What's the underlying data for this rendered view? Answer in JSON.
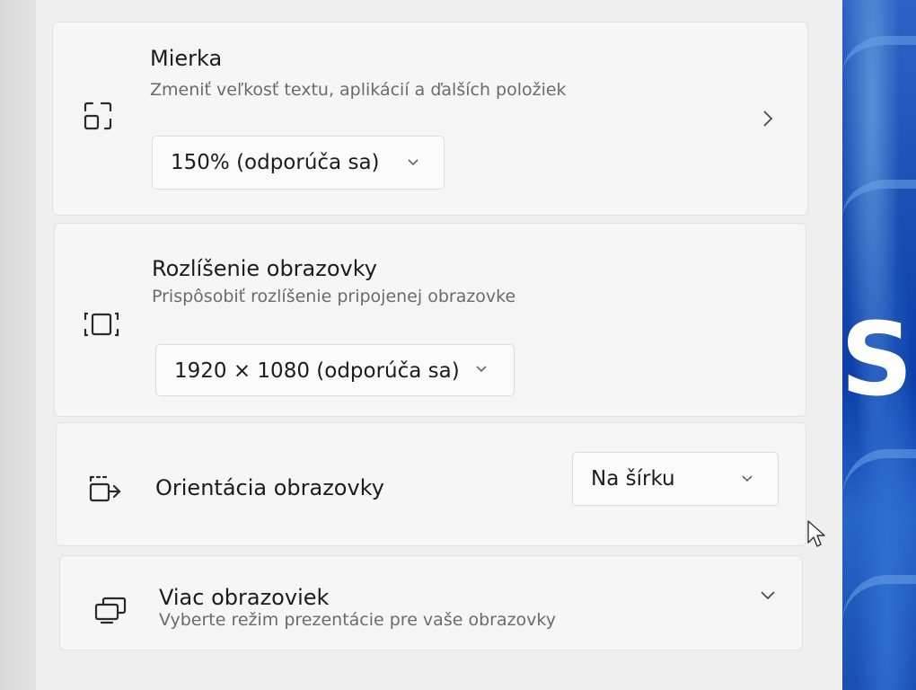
{
  "scale": {
    "title": "Mierka",
    "subtitle": "Zmeniť veľkosť textu, aplikácií a ďalších položiek",
    "value": "150% (odporúča sa)",
    "icon": "scale-icon",
    "trailing_icon": "chevron-right-icon"
  },
  "resolution": {
    "title": "Rozlíšenie obrazovky",
    "subtitle": "Prispôsobiť rozlíšenie pripojenej obrazovke",
    "value": "1920 × 1080 (odporúča sa)",
    "icon": "resolution-icon"
  },
  "orientation": {
    "title": "Orientácia obrazovky",
    "value": "Na šírku",
    "icon": "orientation-icon"
  },
  "multiple_displays": {
    "title": "Viac obrazoviek",
    "subtitle": "Vyberte režim prezentácie pre vaše obrazovky",
    "icon": "multiple-displays-icon",
    "trailing_icon": "chevron-down-icon"
  },
  "wallpaper": {
    "glyph": "S"
  },
  "colors": {
    "accent_wallpaper": "#1b4fb3",
    "card_background": "#f6f6f6",
    "text_primary": "#1c1c1c",
    "text_secondary": "#6b6b6b"
  }
}
